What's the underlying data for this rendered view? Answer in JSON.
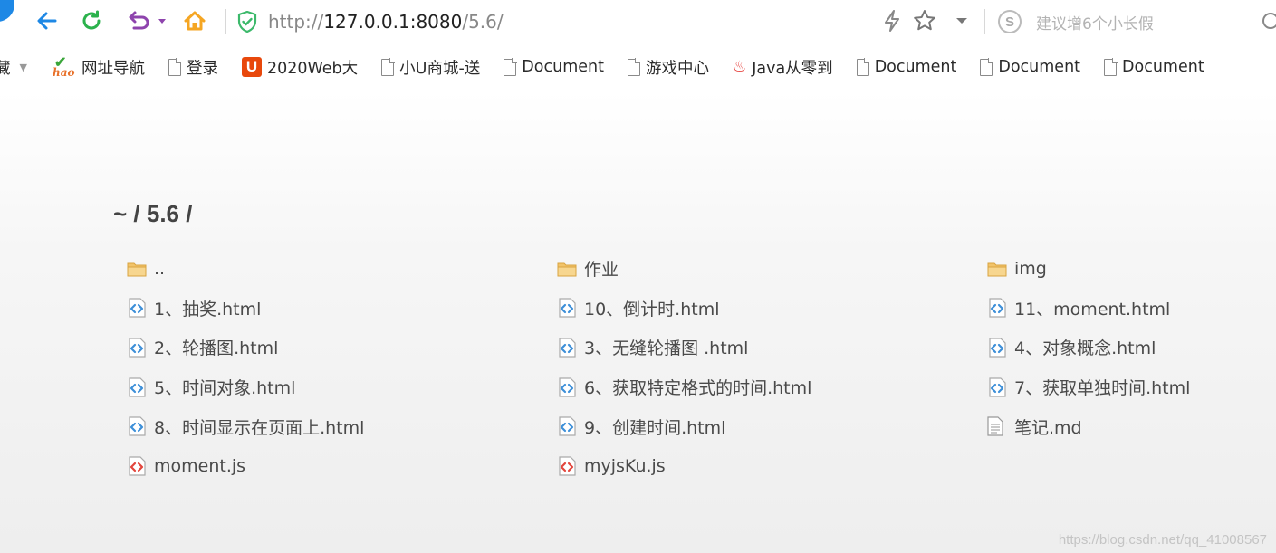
{
  "address_bar": {
    "url_prefix": "http://",
    "url_host": "127.0.0.1:8080",
    "url_path": "/5.6/",
    "search_placeholder": "建议增6个小长假",
    "search_engine_logo": "S"
  },
  "bookmarks": [
    {
      "label": "藏",
      "icon": "none",
      "has_dropdown": true
    },
    {
      "label": "网址导航",
      "icon": "hao-icon"
    },
    {
      "label": "登录",
      "icon": "page-icon"
    },
    {
      "label": "2020Web大",
      "icon": "u-icon",
      "icon_text": "U"
    },
    {
      "label": "小U商城-送",
      "icon": "page-icon"
    },
    {
      "label": "Document",
      "icon": "page-icon"
    },
    {
      "label": "游戏中心",
      "icon": "page-icon"
    },
    {
      "label": "Java从零到",
      "icon": "fire-icon"
    },
    {
      "label": "Document",
      "icon": "page-icon"
    },
    {
      "label": "Document",
      "icon": "page-icon"
    },
    {
      "label": "Document",
      "icon": "page-icon"
    }
  ],
  "hao_icon_text": "hao",
  "listing": {
    "path": "~ / 5.6 /",
    "files": [
      {
        "name": "..",
        "type": "folder"
      },
      {
        "name": "作业",
        "type": "folder"
      },
      {
        "name": "img",
        "type": "folder"
      },
      {
        "name": "1、抽奖.html",
        "type": "html"
      },
      {
        "name": "10、倒计时.html",
        "type": "html"
      },
      {
        "name": "11、moment.html",
        "type": "html"
      },
      {
        "name": "2、轮播图.html",
        "type": "html"
      },
      {
        "name": "3、无缝轮播图 .html",
        "type": "html"
      },
      {
        "name": "4、对象概念.html",
        "type": "html"
      },
      {
        "name": "5、时间对象.html",
        "type": "html"
      },
      {
        "name": "6、获取特定格式的时间.html",
        "type": "html"
      },
      {
        "name": "7、获取单独时间.html",
        "type": "html"
      },
      {
        "name": "8、时间显示在页面上.html",
        "type": "html"
      },
      {
        "name": "9、创建时间.html",
        "type": "html"
      },
      {
        "name": "笔记.md",
        "type": "text"
      },
      {
        "name": "moment.js",
        "type": "js"
      },
      {
        "name": "myjsKu.js",
        "type": "js"
      }
    ]
  },
  "watermark": "https://blog.csdn.net/qq_41008567",
  "colors": {
    "back_arrow": "#1e88e5",
    "refresh": "#2bb24c",
    "undo": "#8e44ad",
    "home": "#f5a623",
    "shield": "#3cb96b",
    "folder": "#f2c46a",
    "html_icon": "#3d8fd8",
    "js_icon": "#e2453c"
  }
}
